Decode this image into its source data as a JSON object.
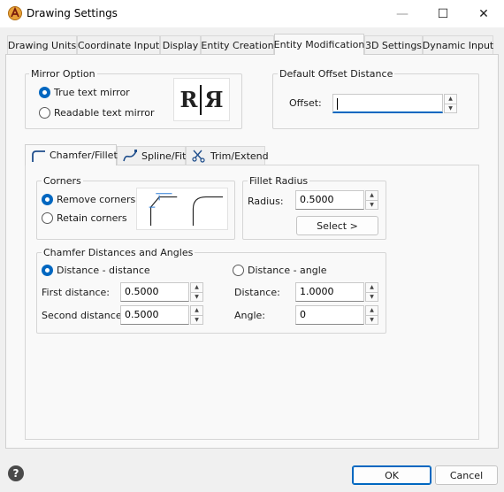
{
  "window": {
    "title": "Drawing Settings",
    "icon": "app-logo-icon",
    "controls": {
      "minimize": "—",
      "maximize": "☐",
      "close": "✕"
    }
  },
  "tabs": [
    {
      "label": "Drawing Units"
    },
    {
      "label": "Coordinate Input"
    },
    {
      "label": "Display"
    },
    {
      "label": "Entity Creation"
    },
    {
      "label": "Entity Modification"
    },
    {
      "label": "3D Settings"
    },
    {
      "label": "Dynamic Input"
    }
  ],
  "active_tab": "Entity Modification",
  "mirror": {
    "title": "Mirror Option",
    "options": [
      {
        "label": "True text mirror",
        "selected": true
      },
      {
        "label": "Readable text mirror",
        "selected": false
      }
    ],
    "preview_text": "R",
    "preview_text_mirrored": "Я"
  },
  "offset": {
    "title": "Default Offset Distance",
    "label": "Offset:",
    "value": ""
  },
  "subtabs": [
    {
      "label": "Chamfer/Fillet",
      "icon": "fillet-icon"
    },
    {
      "label": "Spline/Fit",
      "icon": "spline-icon"
    },
    {
      "label": "Trim/Extend",
      "icon": "trim-icon"
    }
  ],
  "active_subtab": "Chamfer/Fillet",
  "corners": {
    "title": "Corners",
    "options": [
      {
        "label": "Remove corners",
        "selected": true
      },
      {
        "label": "Retain corners",
        "selected": false
      }
    ]
  },
  "fillet": {
    "title": "Fillet Radius",
    "radius_label": "Radius:",
    "radius_value": "0.5000",
    "select_label": "Select  >"
  },
  "chamfer": {
    "title": "Chamfer Distances and Angles",
    "mode_distance": {
      "label": "Distance - distance",
      "selected": true
    },
    "mode_angle": {
      "label": "Distance - angle",
      "selected": false
    },
    "first_label": "First distance:",
    "first_value": "0.5000",
    "second_label": "Second distance:",
    "second_value": "0.5000",
    "distance_label": "Distance:",
    "distance_value": "1.0000",
    "angle_label": "Angle:",
    "angle_value": "0"
  },
  "footer": {
    "help": "?",
    "ok": "OK",
    "cancel": "Cancel"
  },
  "colors": {
    "accent": "#0067c0",
    "panel": "#f9f9f9",
    "window": "#f0f0f0"
  }
}
